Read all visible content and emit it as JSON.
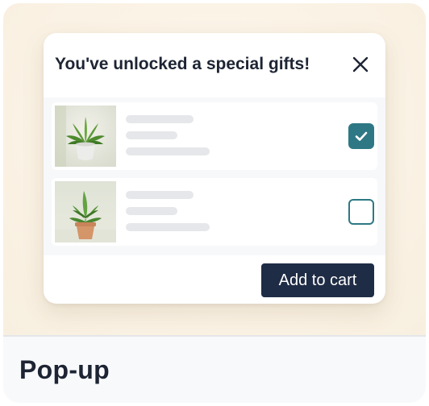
{
  "popup": {
    "title": "You've unlocked a special gifts!",
    "close_icon": "close-icon",
    "items": [
      {
        "image": "potted-plant-white-pot",
        "checked": true
      },
      {
        "image": "potted-plant-terracotta-pot",
        "checked": false
      }
    ],
    "add_button_label": "Add to cart"
  },
  "footer": {
    "title": "Pop-up"
  },
  "colors": {
    "accent": "#2e7885",
    "button": "#1f2c45",
    "title_text": "#1d2433"
  }
}
